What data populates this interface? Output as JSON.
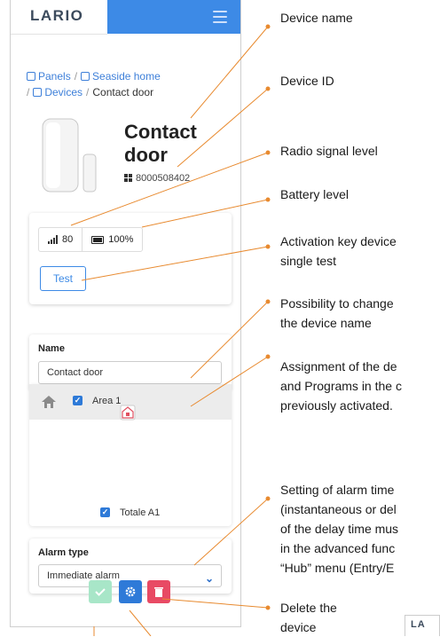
{
  "app": {
    "logo": "LARIO",
    "logo_corner": "LA"
  },
  "breadcrumb": {
    "items": [
      "Panels",
      "Seaside home",
      "Devices"
    ],
    "separator": "/",
    "current": "Contact door"
  },
  "device": {
    "name": "Contact door",
    "id": "8000508402"
  },
  "status": {
    "signal": "80",
    "battery": "100%",
    "test_label": "Test"
  },
  "name_field": {
    "label": "Name",
    "value": "Contact door"
  },
  "area": {
    "label": "Area 1",
    "program": "Totale A1",
    "checked": true
  },
  "alarm": {
    "label": "Alarm type",
    "selected": "Immediate alarm"
  },
  "annotations": {
    "device_name": "Device name",
    "device_id": "Device ID",
    "radio_signal": "Radio signal level",
    "battery": "Battery level",
    "activation_1": "Activation key device",
    "activation_2": "single test",
    "change_name_1": "Possibility to change",
    "change_name_2": "the device name",
    "assign_1": "Assignment of the de",
    "assign_2": "and Programs in the c",
    "assign_3": "previously activated.",
    "alarm_1": "Setting of alarm time",
    "alarm_2": "(instantaneous or del",
    "alarm_3": "of the delay time mus",
    "alarm_4": "in the advanced func",
    "alarm_5": "“Hub” menu (Entry/E",
    "delete_1": "Delete the",
    "delete_2": "device"
  },
  "colors": {
    "accent": "#3d8ae6",
    "annotation_line": "#e88a2f",
    "save": "#a8e6c8",
    "delete": "#e84a64"
  },
  "icons": [
    "menu-icon",
    "chip-icon",
    "qr-icon",
    "signal-icon",
    "battery-icon",
    "home-icon",
    "lock-icon",
    "check-icon",
    "gear-icon",
    "trash-icon",
    "chevron-down-icon"
  ]
}
